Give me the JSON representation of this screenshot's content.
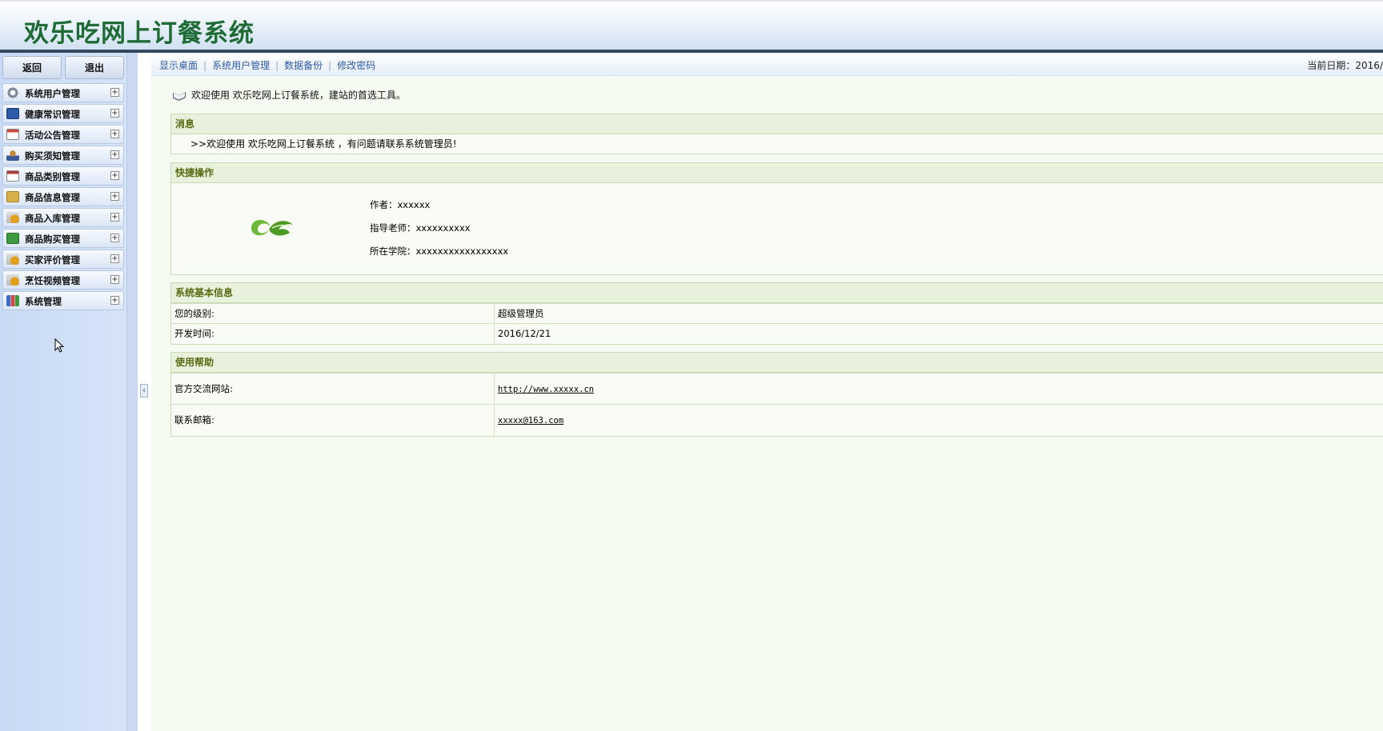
{
  "header": {
    "title": "欢乐吃网上订餐系统"
  },
  "sidebar": {
    "buttons": {
      "back": "返回",
      "logout": "退出"
    },
    "items": [
      {
        "label": "系统用户管理",
        "icon": "gear-icon",
        "color": "#7f8b99"
      },
      {
        "label": "健康常识管理",
        "icon": "monitor-icon",
        "color": "#2d5aa8"
      },
      {
        "label": "活动公告管理",
        "icon": "calendar-icon",
        "color": "#cc4a3a"
      },
      {
        "label": "购买须知管理",
        "icon": "user-icon",
        "color": "#c88a36"
      },
      {
        "label": "商品类别管理",
        "icon": "calendar-icon",
        "color": "#b03a3a"
      },
      {
        "label": "商品信息管理",
        "icon": "folder-icon",
        "color": "#d8b04a"
      },
      {
        "label": "商品入库管理",
        "icon": "coins-icon",
        "color": "#e0a020"
      },
      {
        "label": "商品购买管理",
        "icon": "chart-icon",
        "color": "#3e9b3e"
      },
      {
        "label": "买家评价管理",
        "icon": "coins-icon",
        "color": "#e0a020"
      },
      {
        "label": "烹饪视频管理",
        "icon": "coins-icon",
        "color": "#e0a020"
      },
      {
        "label": "系统管理",
        "icon": "bar-chart-icon",
        "color": "#3a6fcf"
      }
    ]
  },
  "topnav": {
    "links": [
      "显示桌面",
      "系统用户管理",
      "数据备份",
      "修改密码"
    ],
    "date": "当前日期：2016/"
  },
  "main": {
    "welcome": "欢迎使用 欢乐吃网上订餐系统，建站的首选工具。",
    "message": {
      "title": "消息",
      "text": ">>欢迎使用 欢乐吃网上订餐系统 ，有问题请联系系统管理员!"
    },
    "quick": {
      "title": "快捷操作",
      "author": "作者：xxxxxx",
      "teacher": "指导老师：xxxxxxxxxx",
      "college": "所在学院：xxxxxxxxxxxxxxxxx"
    },
    "sysinfo": {
      "title": "系统基本信息",
      "rows": [
        {
          "label": "您的级别:",
          "value": "超级管理员"
        },
        {
          "label": "开发时间:",
          "value": "2016/12/21"
        }
      ]
    },
    "help": {
      "title": "使用帮助",
      "rows": [
        {
          "label": "官方交流网站:",
          "value": "http://www.xxxxx.cn"
        },
        {
          "label": "联系邮箱:",
          "value": "xxxxx@163.com"
        }
      ]
    }
  }
}
